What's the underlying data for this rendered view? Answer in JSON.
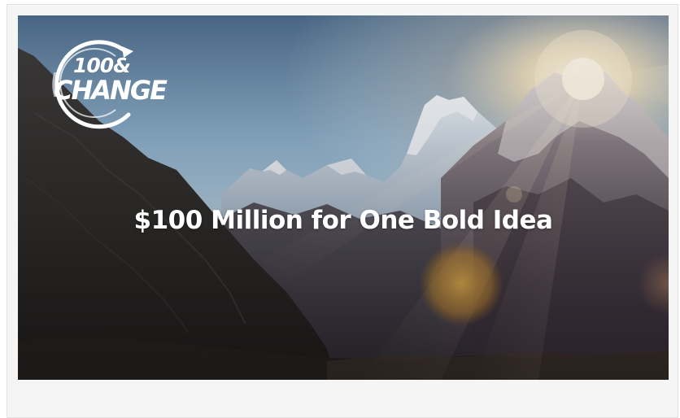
{
  "banner": {
    "logo": {
      "line1": "100&",
      "line2": "CHANGE"
    },
    "headline": "$100 Million for One Bold Idea"
  },
  "colors": {
    "card_background": "#f5f5f5",
    "card_border": "#e2e2e2",
    "text": "#ffffff"
  }
}
